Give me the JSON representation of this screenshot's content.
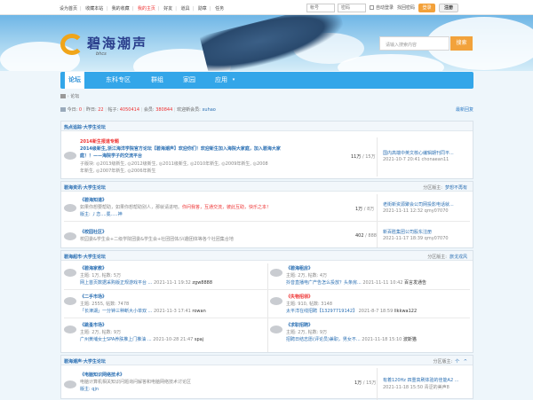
{
  "topbar": {
    "links": [
      "设为首页",
      "收藏本站",
      "我的收藏",
      "我的主页",
      "好友",
      "道具",
      "勋章",
      "任务"
    ],
    "username_placeholder": "帐号",
    "password_placeholder": "密码",
    "autologin": "自动登录",
    "findpwd": "找回密码",
    "login_btn": "登录",
    "register_btn": "注册"
  },
  "banner": {
    "logo_text": "碧海潮声",
    "logo_sub": "bhcs",
    "search_placeholder": "请输入搜索内容",
    "search_btn": "搜索"
  },
  "nav": {
    "items": [
      "论坛",
      "东科专区",
      "群组",
      "家园",
      "应用"
    ]
  },
  "breadcrumb": {
    "label": "论坛"
  },
  "stats": {
    "today_label": "今日:",
    "today": "0",
    "yesterday_label": "昨日:",
    "yesterday": "22",
    "posts_label": "帖子:",
    "posts": "4050414",
    "members_label": "会员:",
    "members": "380844",
    "welcome": "欢迎新会员:",
    "new_member": "xuhao",
    "latest": "最新回复"
  },
  "groups": [
    {
      "title": "热点追踪·大学生论坛",
      "hot_tag": "2014新生报道专题",
      "line1": "2014级新生,浙江海洋学院官方论坛【碧海潮声】欢迎你们！欢迎新生加入海院大家庭，加入碧海大家",
      "line2": "庭！！——海院学子的交流平台",
      "sub1": "子版块: ◎2013级新生, ◎2012级新生, ◎2011级新生, ◎2010年新生, ◎2009年新生, ◎2008",
      "sub2": "年新生, ◎2007年新生, ◎2006年新生",
      "count_a": "11万",
      "count_b": "15万",
      "last_title": "国内高端中英文核心编辑期刊同平...",
      "last_meta": "2021-10-7 20:41 chonaean11"
    },
    {
      "title": "碧海资讯·大学生论坛",
      "right_label": "分区版主:",
      "right_value": "梦想不再有",
      "f1_name": "《碧海知道》",
      "f1_desc": "如果你想要帮助，如果你想帮助别人，那就请进吧。",
      "f1_desc_red": "你问我答，互通交流，彼此互助，快乐之本！",
      "f1_mod": "版主: 丿恋....冕.....神",
      "f1_count_a": "1万",
      "f1_count_b": "8万",
      "f1_last_title": "老街新资源聚会公司网投影电话就...",
      "f1_last_meta": "2021-11-11 12:32 qmy07070",
      "f2_name": "《校园社区》",
      "f2_desc": "校园委&学生会+二级学院团委&学生会+社团团体/兴趣团体等各个社团集合地",
      "f2_count_a": "402",
      "f2_count_b": "888",
      "f2_last_title": "新百胜集团公司股东注册",
      "f2_last_meta": "2021-11-17 18:39 qmy07070"
    },
    {
      "title": "碧海超市·大学生论坛",
      "right_label": "分区版主:",
      "right_value": "旅戈戎风",
      "cells": [
        {
          "name": "《碧海家教》",
          "stats": "主题: 1万, 帖数: 5万",
          "last": "网上首页数据采购版正规游戏平台 ...",
          "time": "2021-11-1 19:32",
          "user": "zgw8888"
        },
        {
          "name": "《碧海租房》",
          "stats": "主题: 2万, 帖数: 4万",
          "last": "抖音直播电广产告怎么投放？头条房...",
          "time": "2021-11-11 10:42",
          "user": "百言发通告"
        },
        {
          "name": "《二手市场》",
          "stats": "主题: 2555, 帖数: 7478",
          "last": "「长津湖」一分钟三种断大小单双 ...",
          "time": "2021-11-3 17:41",
          "user": "rowan"
        },
        {
          "name": "《失物招领》",
          "stats": "主题: 910, 帖数: 3148",
          "last": "太平洋在线招聘【13297719142】",
          "time": "2021-8-7 18:59",
          "user": "llkkwa122"
        },
        {
          "name": "《跳蚤市场》",
          "stats": "主题: 2万, 帖数: 9万",
          "last": "广州黄埔女士SPA养肤推上门推油 ...",
          "time": "2021-10-28 21:47",
          "user": "spaj"
        },
        {
          "name": "《求职招聘》",
          "stats": "主题: 2万, 帖数: 9万",
          "last": "招聘日结志愿(评论员)兼职，男女不...",
          "time": "2021-11-18 15:10",
          "user": "波斯猫"
        }
      ]
    },
    {
      "title": "碧海潮声·大学生论坛",
      "right_label": "分区版主:",
      "right_value": "个",
      "f_name": "《电脑知识网络技术》",
      "f_desc": "电脑计算机相关知识问题询问解答和电脑网络技术讨论区",
      "f_mod": "版主: qjn",
      "count_a": "1万",
      "count_b": "15万",
      "last_title": "有着120Hz 四重高刷体验的佳能A2 ...",
      "last_meta": "2021-11-18 15:50 青涩的美声8"
    }
  ],
  "colors": {
    "nav": "#33a6e9",
    "accent": "#f2a23b",
    "link": "#2a6fb3",
    "hot": "#e33333"
  }
}
